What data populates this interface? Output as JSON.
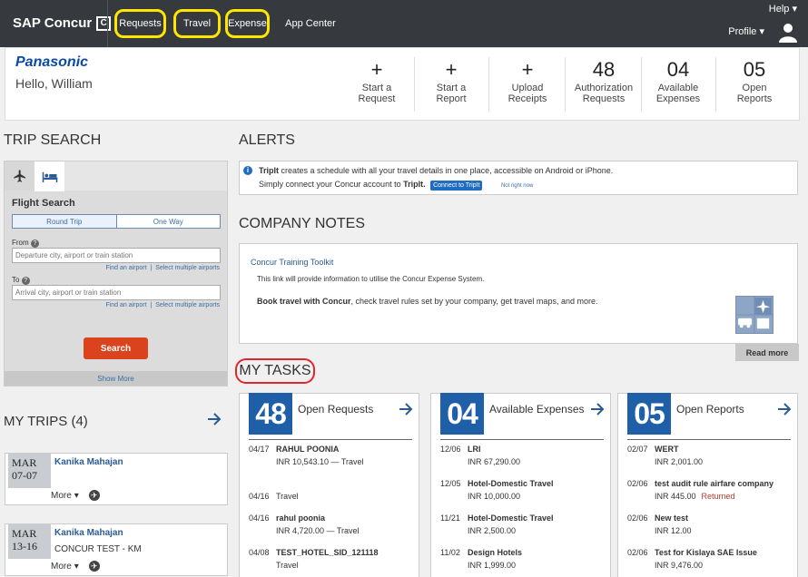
{
  "topbar": {
    "logo_text": "SAP Concur",
    "logo_box": "C",
    "nav": [
      "Requests",
      "Travel",
      "Expense",
      "App Center"
    ],
    "help": "Help ▾",
    "profile": "Profile ▾"
  },
  "header": {
    "brand": "Panasonic",
    "hello": "Hello, William",
    "actions": [
      {
        "big": "+",
        "line1": "Start a",
        "line2": "Request"
      },
      {
        "big": "+",
        "line1": "Start a",
        "line2": "Report"
      },
      {
        "big": "+",
        "line1": "Upload",
        "line2": "Receipts"
      },
      {
        "big": "48",
        "line1": "Authorization",
        "line2": "Requests"
      },
      {
        "big": "04",
        "line1": "Available",
        "line2": "Expenses"
      },
      {
        "big": "05",
        "line1": "Open",
        "line2": "Reports"
      }
    ]
  },
  "trip_search": {
    "title": "TRIP SEARCH",
    "flight_title": "Flight Search",
    "round_trip": "Round Trip",
    "one_way": "One Way",
    "from_label": "From",
    "from_placeholder": "Departure city, airport or train station",
    "to_label": "To",
    "to_placeholder": "Arrival city, airport or train station",
    "find_airport": "Find an airport",
    "sep": "|",
    "select_multiple": "Select multiple airports",
    "search_btn": "Search",
    "show_more": "Show More"
  },
  "my_trips": {
    "title": "MY TRIPS (4)",
    "trips": [
      {
        "month": "MAR",
        "days": "07-07",
        "name": "Kanika Mahajan",
        "sub": "",
        "more": "More"
      },
      {
        "month": "MAR",
        "days": "13-16",
        "name": "Kanika Mahajan",
        "sub": "CONCUR TEST - KM",
        "more": "More"
      }
    ]
  },
  "alerts": {
    "title": "ALERTS",
    "tripit_bold": "TripIt",
    "line1_rest": " creates a schedule with all your travel details in one place, accessible on Android or iPhone.",
    "line2": "Simply connect your Concur account to ",
    "line2_bold": "TripIt.",
    "connect": "Connect to TripIt",
    "not_now": "Not right now"
  },
  "company_notes": {
    "title": "COMPANY NOTES",
    "link": "Concur Training Toolkit",
    "line1": "This link will provide information to utilise the Concur Expense System.",
    "line2_bold": "Book travel with Concur",
    "line2_rest": ", check travel rules set by your company, get travel maps, and more.",
    "read_more": "Read more"
  },
  "my_tasks": {
    "title": "MY TASKS",
    "cards": [
      {
        "num": "48",
        "title": "Open Requests",
        "rows": [
          {
            "date": "04/17",
            "name": "RAHUL POONIA",
            "sub": "INR 10,543.10 — Travel",
            "returned": ""
          },
          {
            "date": "04/16",
            "name": "",
            "sub": "Travel",
            "returned": ""
          },
          {
            "date": "04/16",
            "name": "rahul poonia",
            "sub": "INR 4,720.00 — Travel",
            "returned": ""
          },
          {
            "date": "04/08",
            "name": "TEST_HOTEL_SID_121118",
            "sub": "Travel",
            "returned": ""
          }
        ]
      },
      {
        "num": "04",
        "title": "Available Expenses",
        "rows": [
          {
            "date": "12/06",
            "name": "LRI",
            "sub": "INR 67,290.00",
            "returned": ""
          },
          {
            "date": "12/05",
            "name": "Hotel-Domestic Travel",
            "sub": "INR 10,000.00",
            "returned": ""
          },
          {
            "date": "11/21",
            "name": "Hotel-Domestic Travel",
            "sub": "INR 2,500.00",
            "returned": ""
          },
          {
            "date": "11/02",
            "name": "Design Hotels",
            "sub": "INR 1,999.00",
            "returned": ""
          }
        ]
      },
      {
        "num": "05",
        "title": "Open Reports",
        "rows": [
          {
            "date": "02/07",
            "name": "WERT",
            "sub": "INR 2,001.00",
            "returned": ""
          },
          {
            "date": "02/06",
            "name": "test audit rule airfare company",
            "sub": "INR 445.00",
            "returned": "Returned"
          },
          {
            "date": "02/06",
            "name": "New test",
            "sub": "INR 12.00",
            "returned": ""
          },
          {
            "date": "02/06",
            "name": "Test for Kislaya SAE Issue",
            "sub": "INR 9,476.00",
            "returned": ""
          }
        ]
      }
    ]
  },
  "colors": {
    "topbar": "#363a3e",
    "highlight_yellow": "#ffe500",
    "highlight_red": "#e2242b",
    "task_blue": "#1f5fa8",
    "search_orange": "#d9431e"
  }
}
